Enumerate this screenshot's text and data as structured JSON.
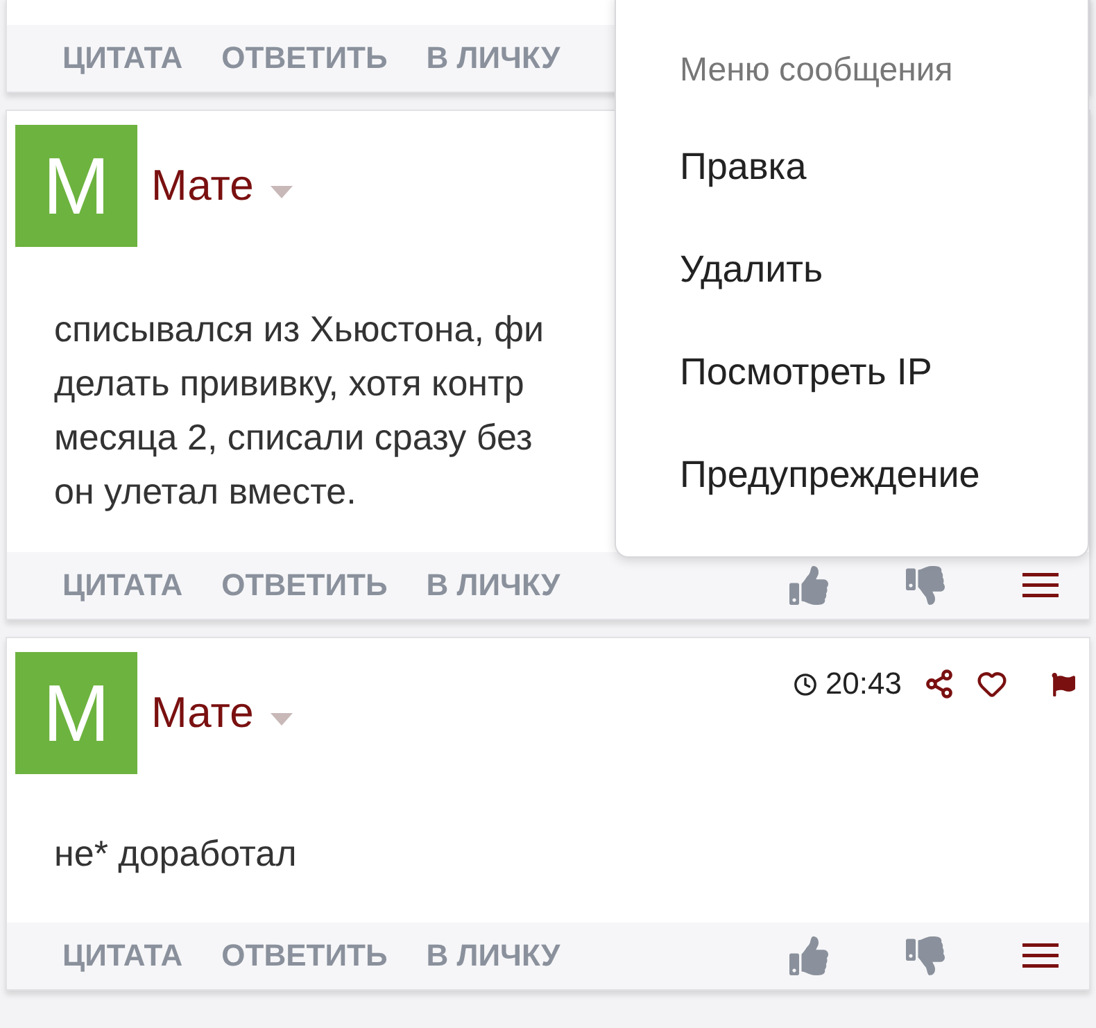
{
  "posts": [
    {
      "kind": "footer_only",
      "actions": [
        "ЦИТАТА",
        "ОТВЕТИТЬ",
        "В ЛИЧКУ"
      ],
      "reactions": false
    },
    {
      "kind": "full",
      "avatar": "M",
      "author": "Мате",
      "body": [
        "списывался из Хьюстона, фи",
        "делать прививку, хотя контр",
        "месяца 2, списали сразу без",
        "он улетал вместе."
      ],
      "actions": [
        "ЦИТАТА",
        "ОТВЕТИТЬ",
        "В ЛИЧКУ"
      ],
      "reactions": true
    },
    {
      "kind": "full",
      "avatar": "M",
      "author": "Мате",
      "time": "20:43",
      "body": [
        "не* доработал"
      ],
      "actions": [
        "ЦИТАТА",
        "ОТВЕТИТЬ",
        "В ЛИЧКУ"
      ],
      "reactions": true
    }
  ],
  "menu": {
    "title": "Меню сообщения",
    "items": [
      "Правка",
      "Удалить",
      "Посмотреть IP",
      "Предупреждение"
    ]
  }
}
